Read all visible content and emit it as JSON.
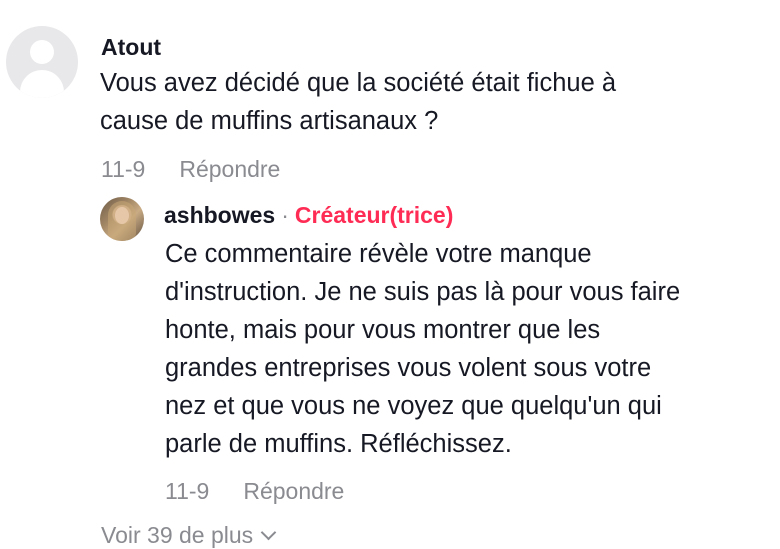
{
  "comment": {
    "username": "Atout",
    "text_line1": "Vous avez décidé que la société était fichue à",
    "text_line2": "cause de muffins artisanaux ?",
    "date": "11-9",
    "reply_label": "Répondre"
  },
  "reply": {
    "username": "ashbowes",
    "separator": "·",
    "badge": "Créateur(trice)",
    "lines": [
      "Ce commentaire révèle votre manque",
      "d'instruction. Je ne suis pas là pour vous faire",
      "honte, mais pour vous montrer que les",
      "grandes entreprises vous volent sous votre",
      "nez et que vous ne voyez que quelqu'un qui",
      "parle de muffins. Réfléchissez."
    ],
    "date": "11-9",
    "reply_label": "Répondre"
  },
  "view_more": {
    "label": "Voir 39 de plus"
  },
  "colors": {
    "text": "#161823",
    "muted": "#8a8b91",
    "creator_badge": "#fe2c55"
  }
}
